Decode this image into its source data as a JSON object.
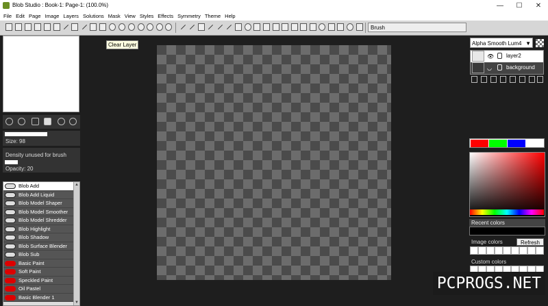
{
  "window": {
    "title": "Blob Studio : Book-1: Page-1: (100.0%)",
    "minimize": "—",
    "maximize": "☐",
    "close": "✕"
  },
  "menu": [
    "File",
    "Edit",
    "Page",
    "Image",
    "Layers",
    "Solutions",
    "Mask",
    "View",
    "Styles",
    "Effects",
    "Symmetry",
    "Theme",
    "Help"
  ],
  "toolbar": {
    "mode_label": "Brush"
  },
  "tooltip": "Clear Layer",
  "left_panel": {
    "size_label": "Size: 98",
    "size_value": 0.58,
    "density_label": "Density unused for brush",
    "opacity_label": "Opacity: 20",
    "opacity_value": 0.18
  },
  "brushes": [
    {
      "label": "Blob Add",
      "selected": true,
      "icon": "blob"
    },
    {
      "label": "Blob Add Liquid",
      "icon": "blob"
    },
    {
      "label": "Blob Model Shaper",
      "icon": "blob"
    },
    {
      "label": "Blob Model Smoother",
      "icon": "blob"
    },
    {
      "label": "Blob Model Shredder",
      "icon": "blob"
    },
    {
      "label": "Blob Highlight",
      "icon": "blob"
    },
    {
      "label": "Blob Shadow",
      "icon": "blob"
    },
    {
      "label": "Blob Surface Blender",
      "icon": "blob"
    },
    {
      "label": "Blob Sub",
      "icon": "blob"
    },
    {
      "label": "Basic Paint",
      "icon": "red"
    },
    {
      "label": "Soft Paint",
      "icon": "red"
    },
    {
      "label": "Speckled Paint",
      "icon": "red"
    },
    {
      "label": "Oil Pastel",
      "icon": "red"
    },
    {
      "label": "Basic Blender 1",
      "icon": "red"
    }
  ],
  "layers_panel": {
    "blend_mode": "Alpha Smooth Lum4",
    "layers": [
      {
        "name": "layer2"
      },
      {
        "name": "background"
      }
    ]
  },
  "colors": {
    "swatches": [
      "#ff0000",
      "#00ff00",
      "#0000ff",
      "#ffffff"
    ],
    "recent_label": "Recent colors",
    "image_label": "Image colors",
    "refresh_label": "Refresh",
    "custom_label": "Custom colors"
  },
  "watermark": "PCPROGS.NET"
}
